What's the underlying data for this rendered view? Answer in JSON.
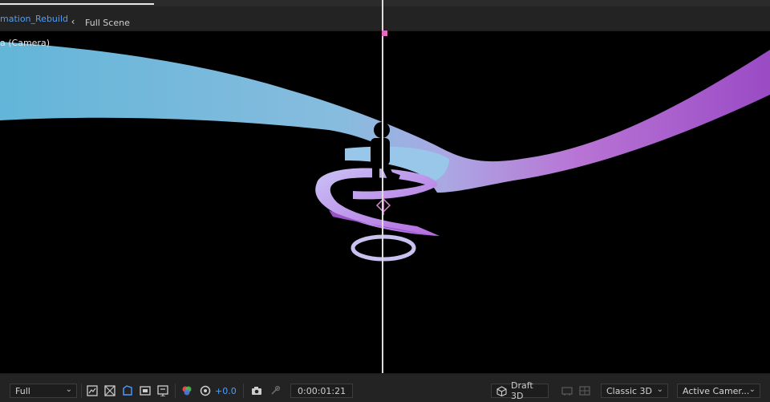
{
  "composition": {
    "active_tab": "mation_Rebuild",
    "second_tab": "Full Scene"
  },
  "viewer": {
    "camera_label": "a (Camera)",
    "ribbon_colors": {
      "start": "#6ec3e6",
      "mid": "#b8b2f0",
      "end": "#b25ad8"
    }
  },
  "toolbar": {
    "resolution": "Full",
    "exposure": "+0.0",
    "timecode": "0:00:01:21",
    "renderer_button": "Draft 3D",
    "renderer": "Classic 3D",
    "view": "Active Camer..."
  },
  "colors": {
    "accent_blue": "#4b9fff",
    "playhead_marker": "#e36bbf",
    "panel_bg": "#232323"
  },
  "icons": [
    "snapshot-icon",
    "transparency-grid-icon",
    "mask-path-icon",
    "region-of-interest-icon",
    "guides-icon",
    "color-channel-icon",
    "exposure-reset-icon",
    "camera-snapshot-icon",
    "show-snapshot-icon",
    "draft3d-cube-icon",
    "3d-ground-plane-icon",
    "extended-viewer-icon"
  ]
}
